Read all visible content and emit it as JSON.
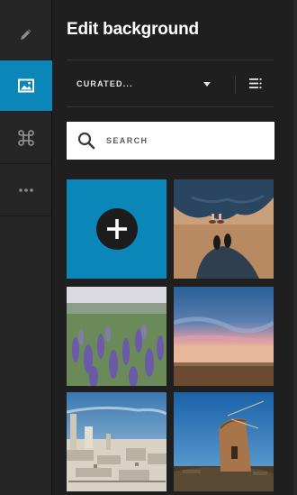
{
  "rail": {
    "items": [
      {
        "icon": "pencil-icon",
        "active": false
      },
      {
        "icon": "image-icon",
        "active": true
      },
      {
        "icon": "command-icon",
        "active": false
      },
      {
        "icon": "more-icon",
        "active": false
      }
    ]
  },
  "panel": {
    "title": "Edit background",
    "dropdown": {
      "selected": "CURATED..."
    },
    "search": {
      "placeholder": "SEARCH"
    },
    "tiles": [
      {
        "kind": "add-background",
        "icon": "plus-icon"
      },
      {
        "kind": "photo",
        "subject": "feet-standing"
      },
      {
        "kind": "photo",
        "subject": "lavender-field"
      },
      {
        "kind": "photo",
        "subject": "sunset-sky"
      },
      {
        "kind": "photo",
        "subject": "city-rooftops"
      },
      {
        "kind": "photo",
        "subject": "windmill-tower"
      }
    ]
  },
  "colors": {
    "accent": "#0a86b8",
    "rail_bg": "#262626",
    "panel_bg": "#1f1f1f",
    "text": "#ffffff"
  }
}
